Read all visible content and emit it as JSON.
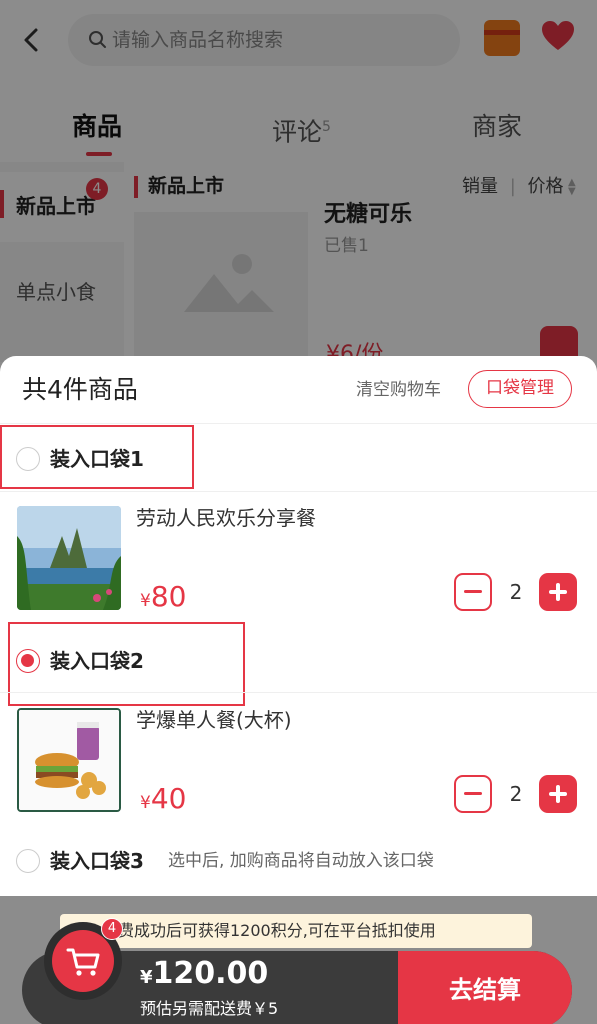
{
  "search": {
    "placeholder": "请输入商品名称搜索"
  },
  "tabs": [
    {
      "label": "商品",
      "count": ""
    },
    {
      "label": "评论",
      "count": "5"
    },
    {
      "label": "商家",
      "count": ""
    }
  ],
  "sidebar": {
    "items": [
      {
        "label": "新品上市",
        "badge": "4"
      },
      {
        "label": "单点小食"
      }
    ]
  },
  "section": {
    "title": "新品上市",
    "sort_sales": "销量",
    "sort_sep": "|",
    "sort_price": "价格"
  },
  "bg_product": {
    "title": "无糖可乐",
    "sold": "已售1",
    "price": "¥6/份"
  },
  "cart": {
    "title": "共4件商品",
    "clear_label": "清空购物车",
    "pocket_manage_label": "口袋管理",
    "pockets": [
      {
        "label": "装入口袋1",
        "selected": false,
        "item": {
          "name": "劳动人民欢乐分享餐",
          "currency": "¥",
          "price": "80",
          "qty": "2"
        }
      },
      {
        "label": "装入口袋2",
        "selected": true,
        "item": {
          "name": "学爆单人餐(大杯)",
          "currency": "¥",
          "price": "40",
          "qty": "2"
        }
      },
      {
        "label": "装入口袋3",
        "selected": false,
        "hint": "选中后, 加购商品将自动放入该口袋"
      }
    ]
  },
  "notice": {
    "text": "费成功后可获得1200积分,可在平台抵扣使用"
  },
  "checkout": {
    "badge": "4",
    "currency": "¥",
    "total": "120.00",
    "delivery_note": "预估另需配送费￥5",
    "button_label": "去结算"
  },
  "colors": {
    "accent": "#e53645",
    "bar": "#3b3b3b",
    "notice_bg": "#fdf3dc"
  },
  "icons": {
    "back": "chevron-left-icon",
    "search": "search-icon",
    "gift": "red-envelope-icon",
    "favorite": "heart-icon",
    "cart": "shopping-cart-icon"
  }
}
